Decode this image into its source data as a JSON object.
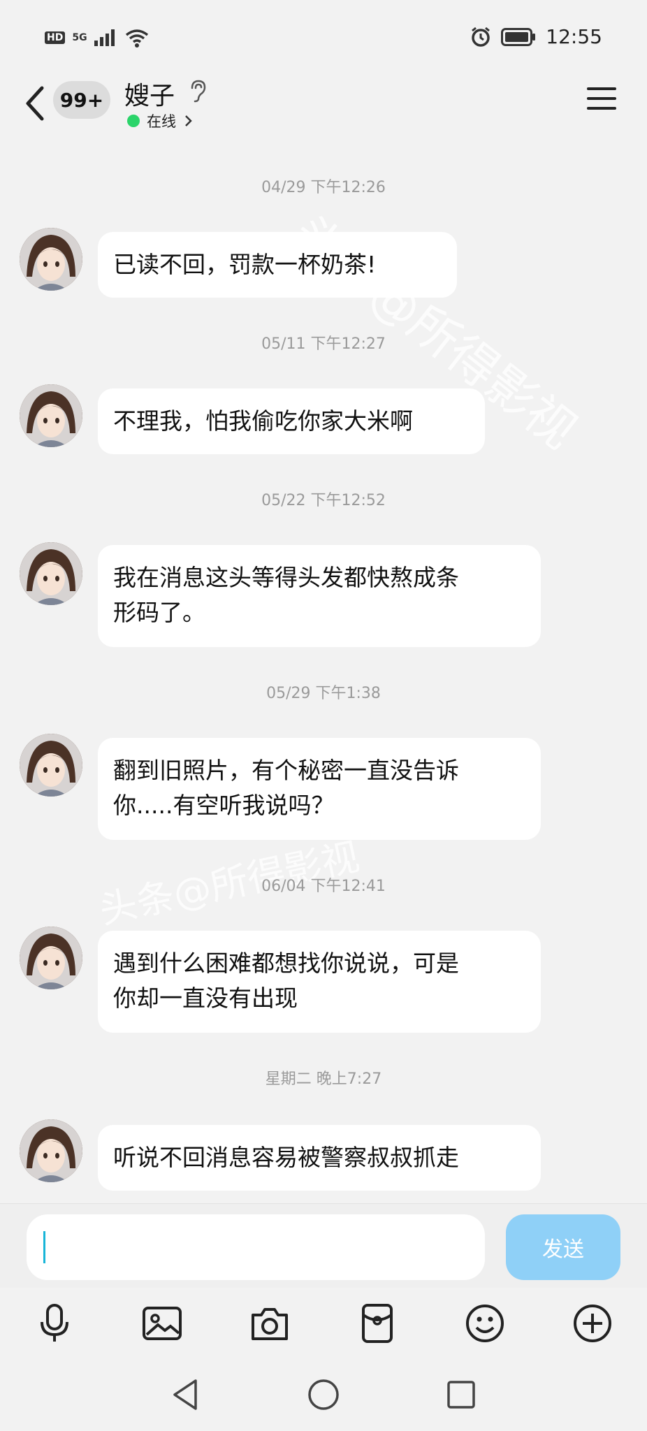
{
  "status_bar": {
    "hd": "HD",
    "network": "5G",
    "time": "12:55"
  },
  "header": {
    "unread_badge": "99+",
    "title": "嫂子",
    "status": "在线"
  },
  "messages": [
    {
      "time": "04/29 下午12:26",
      "text": "已读不回，罚款一杯奶茶!"
    },
    {
      "time": "05/11 下午12:27",
      "text": "不理我，怕我偷吃你家大米啊"
    },
    {
      "time": "05/22 下午12:52",
      "text": "我在消息这头等得头发都快熬成条\n形码了。"
    },
    {
      "time": "05/29 下午1:38",
      "text": "翻到旧照片，有个秘密一直没告诉\n你.....有空听我说吗？"
    },
    {
      "time": "06/04 下午12:41",
      "text": "遇到什么困难都想找你说说，可是\n你却一直没有出现"
    },
    {
      "time": "星期二 晚上7:27",
      "text": "听说不回消息容易被警察叔叔抓走"
    }
  ],
  "input": {
    "send_label": "发送"
  },
  "watermarks": [
    "头条@所得影视",
    "头条@所得影视"
  ],
  "colors": {
    "online": "#2bd46a",
    "send_button": "#8fd0f7",
    "caret": "#18b5d8"
  },
  "icons": [
    "back-icon",
    "ear-icon",
    "menu-icon",
    "microphone-icon",
    "image-icon",
    "camera-icon",
    "red-packet-icon",
    "emoji-icon",
    "plus-icon",
    "nav-back-icon",
    "nav-home-icon",
    "nav-recents-icon"
  ]
}
